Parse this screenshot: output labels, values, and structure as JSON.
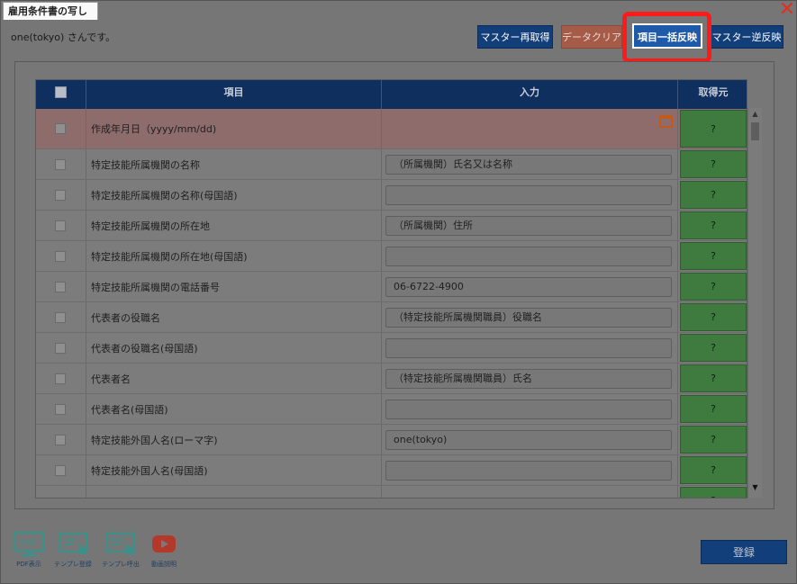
{
  "window": {
    "title": "雇用条件書の写し",
    "close_glyph": "✕"
  },
  "greeting": "one(tokyo) さんです。",
  "toolbar": {
    "master_refetch": "マスター再取得",
    "data_clear": "データクリア",
    "bulk_apply": "項目一括反映",
    "master_reverse": "マスター逆反映"
  },
  "table": {
    "headers": {
      "item": "項目",
      "input": "入力",
      "source": "取得元"
    },
    "rows": [
      {
        "label": "作成年月日（yyyy/mm/dd)",
        "value": "",
        "source": "?"
      },
      {
        "label": "特定技能所属機関の名称",
        "value": "（所属機関）氏名又は名称",
        "source": "?"
      },
      {
        "label": "特定技能所属機関の名称(母国語)",
        "value": "",
        "source": "?"
      },
      {
        "label": "特定技能所属機関の所在地",
        "value": "（所属機関）住所",
        "source": "?"
      },
      {
        "label": "特定技能所属機関の所在地(母国語)",
        "value": "",
        "source": "?"
      },
      {
        "label": "特定技能所属機関の電話番号",
        "value": "06-6722-4900",
        "source": "?"
      },
      {
        "label": "代表者の役職名",
        "value": "（特定技能所属機関職員）役職名",
        "source": "?"
      },
      {
        "label": "代表者の役職名(母国語)",
        "value": "",
        "source": "?"
      },
      {
        "label": "代表者名",
        "value": "（特定技能所属機関職員）氏名",
        "source": "?"
      },
      {
        "label": "代表者名(母国語)",
        "value": "",
        "source": "?"
      },
      {
        "label": "特定技能外国人名(ローマ字)",
        "value": "one(tokyo)",
        "source": "?"
      },
      {
        "label": "特定技能外国人名(母国語)",
        "value": "",
        "source": "?"
      },
      {
        "label": "",
        "value": "",
        "source": "?"
      }
    ]
  },
  "bottom_tools": {
    "pdf": {
      "icon_text": "PDF",
      "label": "PDF表示"
    },
    "template_register": {
      "label": "テンプレ登録"
    },
    "template_call": {
      "label": "テンプレ呼出"
    },
    "video": {
      "label": "動画説明"
    }
  },
  "register_button": "登録",
  "colors": {
    "primary": "#123e7a",
    "clear_button": "#a65a48",
    "highlight_border": "#ff1a1a",
    "source_green": "#3f7a3f",
    "first_row": "#8e6c6c",
    "close": "#e03020"
  }
}
